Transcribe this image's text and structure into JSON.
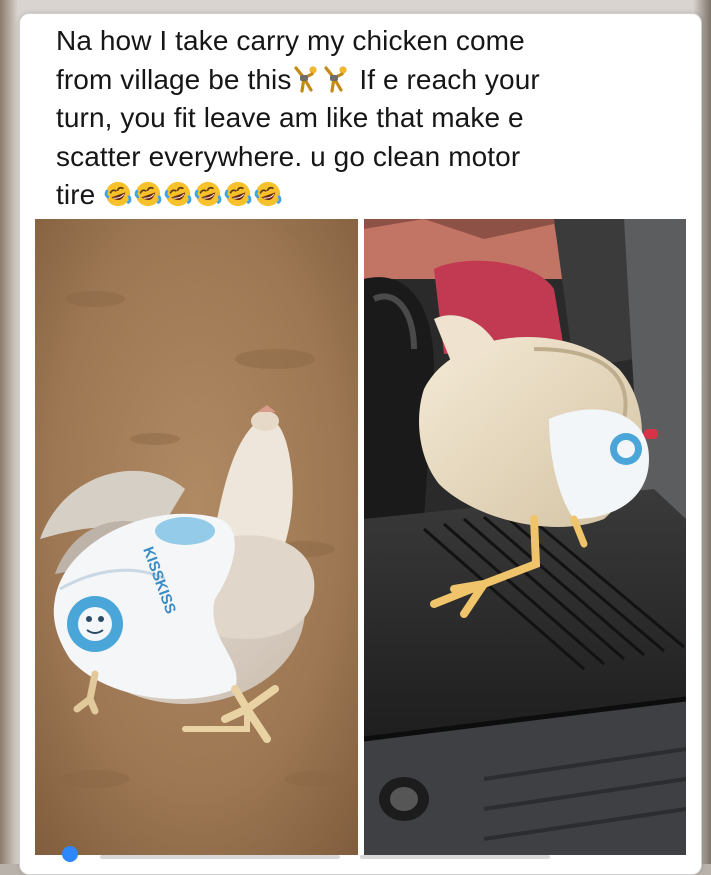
{
  "post": {
    "line1": "Na how I take carry my chicken come",
    "line2a": "from village be this",
    "line2b": " If e reach your",
    "line3": "turn, you fit leave am like that make e",
    "line4": "scatter everywhere.  u go clean motor",
    "line5": "tire"
  },
  "emojis": {
    "dancing": "man-cartwheeling-icon",
    "laughing": "rolling-on-floor-laughing-icon",
    "laughing_count": 6
  },
  "photos": {
    "left": {
      "diaper_brand": "KISSKISS"
    },
    "right": {}
  },
  "colors": {
    "card_bg": "#ffffff",
    "text": "#161616",
    "ground": "#a27d58",
    "trunk": "#2a2a2a",
    "diaper_blue": "#4aa6d8"
  }
}
